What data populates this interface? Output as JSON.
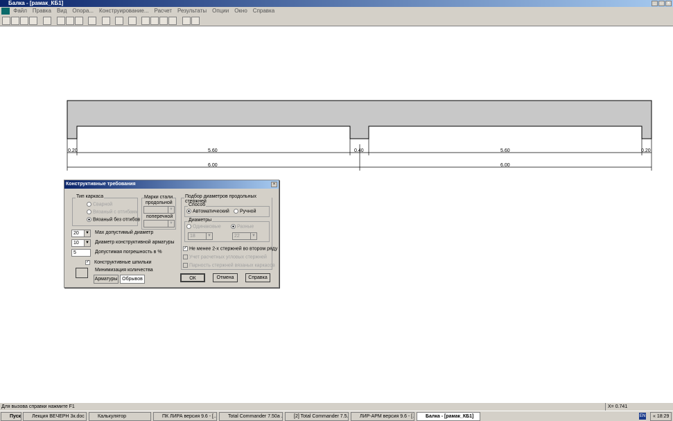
{
  "window": {
    "title": "Балка - [рамак_КБ1]"
  },
  "menu": [
    "Файл",
    "Правка",
    "Вид",
    "Опора...",
    "Конструирование...",
    "Расчет",
    "Результаты",
    "Опции",
    "Окно",
    "Справка"
  ],
  "beam": {
    "dims_top": [
      "0.20",
      "5.60",
      "0.40",
      "5.60",
      "0.20"
    ],
    "dims_bottom": [
      "6.00",
      "6.00"
    ]
  },
  "dialog": {
    "title": "Конструктивные требования",
    "frame_type": {
      "label": "Тип каркаса",
      "options": [
        "Сварной",
        "Вязаный с отгибами",
        "Вязаный без отгибов"
      ],
      "selected": 2
    },
    "steel": {
      "label": "Марки стали",
      "longitudinal": "продольной",
      "transverse": "поперечной"
    },
    "max_diam": {
      "value": "20",
      "label": "Мах допустимый диаметр"
    },
    "constr_diam": {
      "value": "10",
      "label": "Диаметр конструктивной арматуры"
    },
    "tolerance": {
      "value": "5",
      "label": "Допустимая погрешность в %"
    },
    "pins": {
      "label": "Конструктивные шпильки",
      "checked": true
    },
    "minimize": {
      "label": "Минимизация количества",
      "btn1": "Арматуры",
      "btn2": "Обрывов"
    },
    "selection": {
      "label": "Подбор диаметров продольных стержней",
      "method": "Способ",
      "auto": "Автоматический",
      "manual": "Ручной",
      "diameters": "Диаметры",
      "same": "Одинаковые",
      "different": "Разные",
      "d1": "18",
      "d2": "22"
    },
    "checks": [
      "Не менее 2-х стержней во втором ряду",
      "Учет расчетных угловых стержней",
      "Парность стержней вязаных каркасов"
    ],
    "ok": "ОК",
    "cancel": "Отмена",
    "help": "Справка"
  },
  "status": {
    "hint": "Для вызова справки нажмите F1",
    "coord": "X= 0.741"
  },
  "taskbar": {
    "start": "Пуск",
    "items": [
      "Лекция ВЕЧЕРН 3к.doc ...",
      "Калькулятор",
      "ПК ЛИРА версия 9.6 - [...",
      "Total Commander 7.50a ...",
      "[2] Total Commander 7.5...",
      "ЛИР-АРМ версия 9.6 - [...",
      "Балка - [рамак_КБ1]"
    ],
    "lang": "EN",
    "time": "18:29"
  }
}
